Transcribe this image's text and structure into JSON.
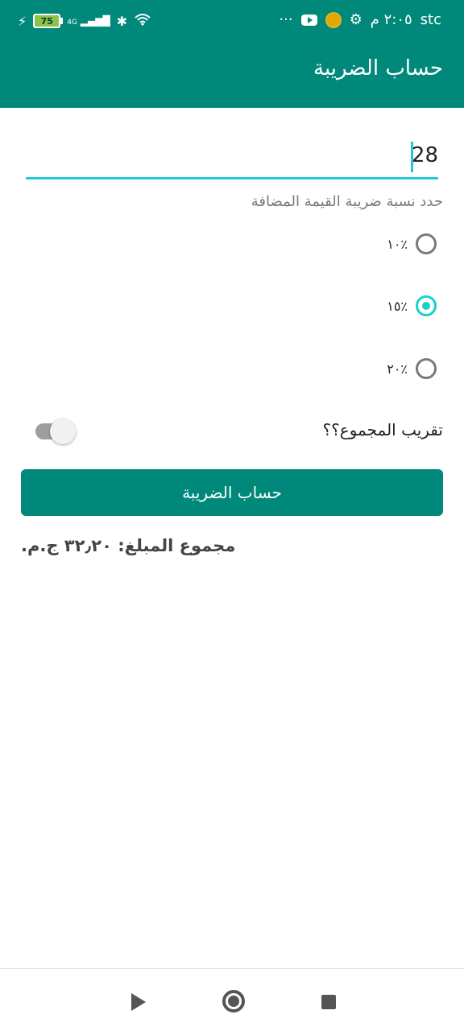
{
  "status_bar": {
    "battery_level": "75",
    "network": "4G",
    "time": "٢:٠٥ م",
    "carrier": "stc",
    "more_icon": "···",
    "icons": [
      "charging-icon",
      "battery-icon",
      "signal-icon",
      "bluetooth-icon",
      "wifi-icon",
      "more-icon",
      "youtube-icon",
      "app-icon",
      "settings-icon"
    ]
  },
  "toolbar": {
    "title": "حساب الضريبة"
  },
  "form": {
    "amount_value": "28",
    "vat_hint": "حدد نسبة ضريبة القيمة المضافة",
    "rates": [
      {
        "label": "٪١٠",
        "checked": false
      },
      {
        "label": "٪١٥",
        "checked": true
      },
      {
        "label": "٪٢٠",
        "checked": false
      }
    ],
    "round_label": "تقريب المجموع؟؟",
    "round_enabled": false,
    "calculate_label": "حساب الضريبة"
  },
  "result": {
    "text": "مجموع المبلغ: ٣٢٫٢٠ ج.م."
  },
  "colors": {
    "primary": "#00897b",
    "accent": "#1ecfc9"
  }
}
